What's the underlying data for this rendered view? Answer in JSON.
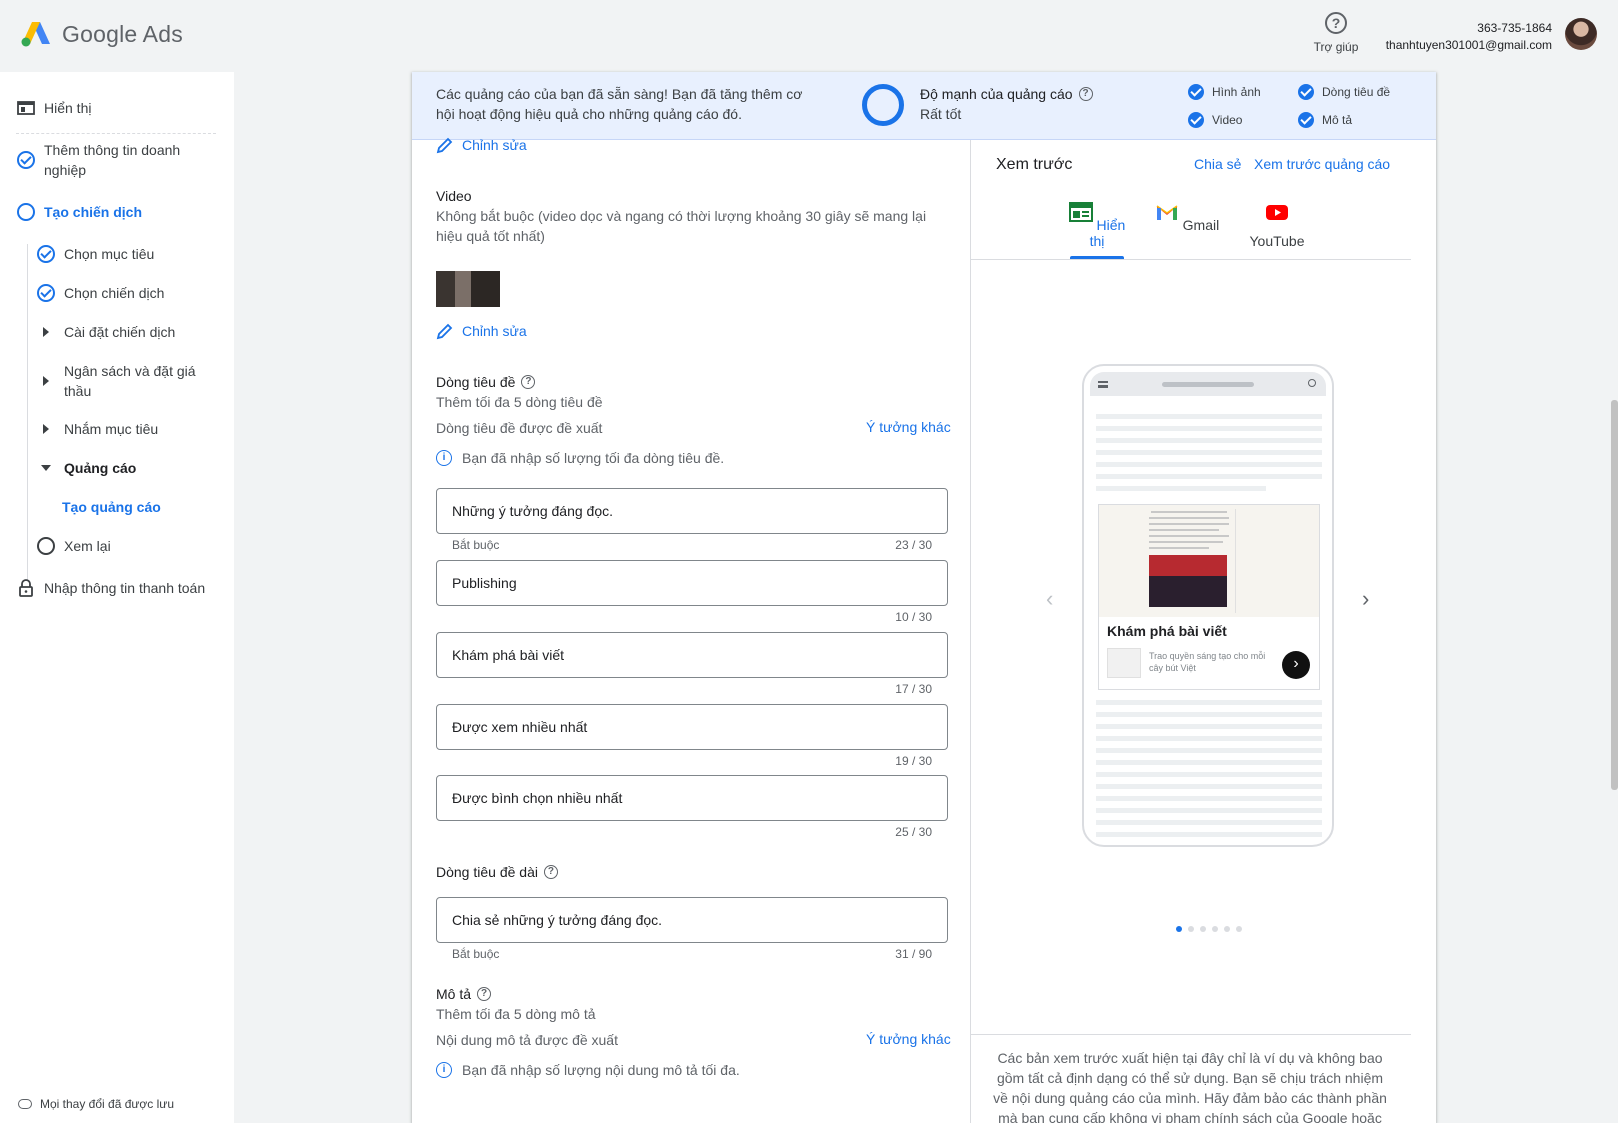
{
  "header": {
    "app_name": "Google Ads",
    "help_label": "Trợ giúp",
    "account_id": "363-735-1864",
    "account_email": "thanhtuyen301001@gmail.com"
  },
  "sidebar": {
    "items": [
      {
        "label": "Hiển thị"
      },
      {
        "label": "Thêm thông tin doanh nghiệp"
      },
      {
        "label": "Tạo chiến dịch"
      },
      {
        "label": "Chọn mục tiêu"
      },
      {
        "label": "Chọn chiến dịch"
      },
      {
        "label": "Cài đặt chiến dịch"
      },
      {
        "label": "Ngân sách và đặt giá thầu"
      },
      {
        "label": "Nhắm mục tiêu"
      },
      {
        "label": "Quảng cáo"
      },
      {
        "label": "Tạo quảng cáo"
      },
      {
        "label": "Xem lại"
      },
      {
        "label": "Nhập thông tin thanh toán"
      }
    ],
    "saved_status": "Mọi thay đổi đã được lưu"
  },
  "banner": {
    "message": "Các quảng cáo của bạn đã sẵn sàng! Bạn đã tăng thêm cơ hội hoạt động hiệu quả cho những quảng cáo đó.",
    "strength_title": "Độ mạnh của quảng cáo",
    "strength_value": "Rất tốt",
    "requirements": [
      "Hình ảnh",
      "Dòng tiêu đề",
      "Video",
      "Mô tả"
    ]
  },
  "form": {
    "edit_label": "Chỉnh sửa",
    "video": {
      "title": "Video",
      "help": "Không bắt buộc (video dọc và ngang có thời lượng khoảng 30 giây sẽ mang lại hiệu quả tốt nhất)"
    },
    "headlines": {
      "title": "Dòng tiêu đề",
      "subtitle": "Thêm tối đa 5 dòng tiêu đề",
      "suggested_label": "Dòng tiêu đề được đề xuất",
      "more_ideas": "Ý tưởng khác",
      "info": "Bạn đã nhập số lượng tối đa dòng tiêu đề.",
      "required_label": "Bắt buộc",
      "fields": [
        {
          "value": "Những ý tưởng đáng đọc.",
          "count": "23 / 30"
        },
        {
          "value": "Publishing",
          "count": "10 / 30"
        },
        {
          "value": "Khám phá bài viết",
          "count": "17 / 30"
        },
        {
          "value": "Được xem nhiều nhất",
          "count": "19 / 30"
        },
        {
          "value": "Được bình chọn nhiều nhất",
          "count": "25 / 30"
        }
      ]
    },
    "long_headline": {
      "title": "Dòng tiêu đề dài",
      "value": "Chia sẻ những ý tưởng đáng đọc.",
      "required_label": "Bắt buộc",
      "count": "31 / 90"
    },
    "descriptions": {
      "title": "Mô tả",
      "subtitle": "Thêm tối đa 5 dòng mô tả",
      "suggested_label": "Nội dung mô tả được đề xuất",
      "more_ideas": "Ý tưởng khác",
      "info": "Bạn đã nhập số lượng nội dung mô tả tối đa."
    }
  },
  "preview": {
    "title": "Xem trước",
    "share": "Chia sẻ",
    "preview_ads": "Xem trước quảng cáo",
    "tabs": [
      {
        "label": "Hiển thị",
        "active": true
      },
      {
        "label": "Gmail",
        "active": false
      },
      {
        "label": "YouTube",
        "active": false
      }
    ],
    "ad": {
      "headline": "Khám phá bài viết",
      "description": "Trao quyền sáng tạo cho mỗi cây bút Việt"
    },
    "page_dots": 6,
    "active_dot": 1,
    "disclaimer": "Các bản xem trước xuất hiện tại đây chỉ là ví dụ và không bao gồm tất cả định dạng có thể sử dụng. Bạn sẽ chịu trách nhiệm về nội dung quảng cáo của mình. Hãy đảm bảo các thành phần mà bạn cung cấp không vi phạm chính sách của Google hoặc"
  },
  "colors": {
    "accent": "#1a73e8",
    "banner_bg": "#e8f0fe",
    "page_bg": "#f1f3f4"
  }
}
